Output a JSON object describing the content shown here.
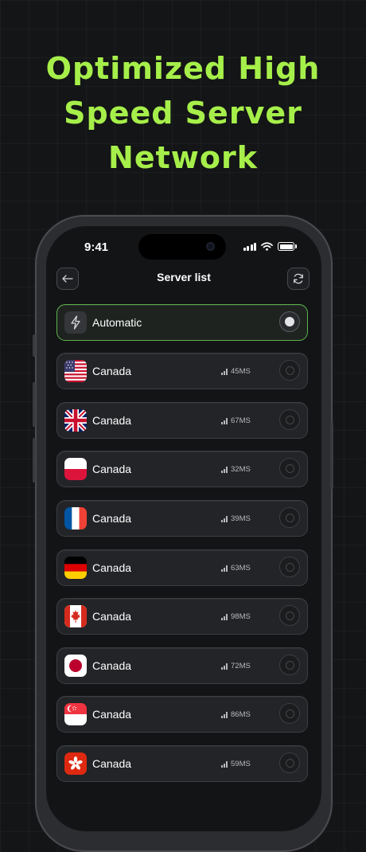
{
  "headline": [
    "Optimized High",
    "Speed Server",
    "Network"
  ],
  "status_bar": {
    "time": "9:41"
  },
  "header": {
    "title": "Server list",
    "back_icon": "arrow-left-icon",
    "refresh_icon": "refresh-icon"
  },
  "colors": {
    "accent": "#a6ef4a",
    "selected_border": "#5cb34a"
  },
  "automatic": {
    "label": "Automatic",
    "icon": "lightning-bolt-icon",
    "selected": true
  },
  "servers": [
    {
      "flag": "usa",
      "label": "Canada",
      "ping": "45MS"
    },
    {
      "flag": "uk",
      "label": "Canada",
      "ping": "67MS"
    },
    {
      "flag": "poland",
      "label": "Canada",
      "ping": "32MS"
    },
    {
      "flag": "france",
      "label": "Canada",
      "ping": "39MS"
    },
    {
      "flag": "germany",
      "label": "Canada",
      "ping": "63MS"
    },
    {
      "flag": "canada",
      "label": "Canada",
      "ping": "98MS"
    },
    {
      "flag": "japan",
      "label": "Canada",
      "ping": "72MS"
    },
    {
      "flag": "singapore",
      "label": "Canada",
      "ping": "86MS"
    },
    {
      "flag": "hong-kong",
      "label": "Canada",
      "ping": "59MS"
    }
  ]
}
